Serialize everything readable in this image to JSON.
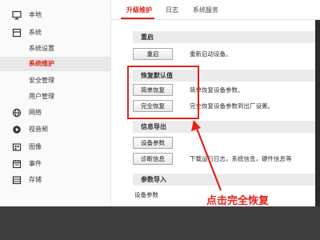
{
  "sidebar": {
    "items": [
      {
        "label": "本地",
        "icon": "monitor-icon"
      },
      {
        "label": "系统",
        "icon": "system-box-icon"
      },
      {
        "label": "系统设置",
        "icon": ""
      },
      {
        "label": "系统维护",
        "icon": ""
      },
      {
        "label": "安全管理",
        "icon": ""
      },
      {
        "label": "用户管理",
        "icon": ""
      },
      {
        "label": "网络",
        "icon": "globe-icon"
      },
      {
        "label": "视音频",
        "icon": "video-audio-icon"
      },
      {
        "label": "图像",
        "icon": "image-icon"
      },
      {
        "label": "事件",
        "icon": "calendar-icon"
      },
      {
        "label": "存储",
        "icon": "storage-icon"
      }
    ]
  },
  "tabs": [
    "升级维护",
    "日志",
    "系统服务"
  ],
  "sections": {
    "restart": {
      "title": "重启",
      "button": "重启",
      "desc": "重新启动设备。"
    },
    "restore": {
      "title": "恢复默认值",
      "simple_button": "简单恢复",
      "simple_desc": "简单恢复设备参数。",
      "full_button": "完全恢复",
      "full_desc": "完全恢复设备参数到出厂设置。"
    },
    "export": {
      "title": "信息导出",
      "device_params_button": "设备参数",
      "diagnostic_button": "诊断信息",
      "diagnostic_desc": "下载运行日志，系统信息，硬件信息等"
    },
    "import": {
      "title": "参数导入",
      "label": "设备参数"
    }
  },
  "annotation": "点击完全恢复",
  "colors": {
    "accent": "#d9261c",
    "annotation_red": "#e2231a",
    "section_header_bg": "#ebebeb"
  }
}
